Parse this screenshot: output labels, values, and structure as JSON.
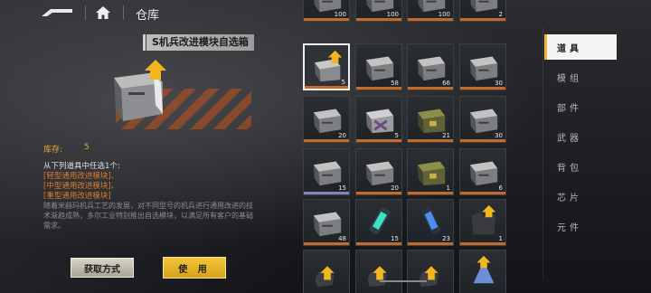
{
  "header": {
    "title": "仓库",
    "back_icon": "back-arrow-icon",
    "home_icon": "home-icon"
  },
  "detail": {
    "item_name": "S机兵改进模块自选箱",
    "stock_label": "库存:",
    "stock_value": "5",
    "choose_text": "从下列道具中任选1个:",
    "options": [
      "[轻型通用改进模块]、",
      "[中型通用改进模块]、",
      "[重型通用改进模块]"
    ],
    "flavor": "随着米赫玛机兵工艺的发展，对不同型号的机兵进行通用改进的技术渐趋成熟，多尔工业特别推出自选模块，以满足所有客户的基础需求。"
  },
  "buttons": {
    "acquire_label": "获取方式",
    "use_label": "使 用"
  },
  "colors": {
    "accent_yellow": "#f0c63c",
    "orange": "#e07a2c",
    "stock": "#e8a63c"
  },
  "grid": {
    "rows": [
      [
        {
          "count": "100",
          "bar": "#c46a2a",
          "icon": "crate"
        },
        {
          "count": "100",
          "bar": "#c46a2a",
          "icon": "crate"
        },
        {
          "count": "100",
          "bar": "#c46a2a",
          "icon": "crate"
        },
        {
          "count": "2",
          "bar": "#c46a2a",
          "icon": "crate"
        }
      ],
      [
        {
          "count": "5",
          "bar": "#c46a2a",
          "icon": "crate-arrow",
          "selected": true
        },
        {
          "count": "58",
          "bar": "#c46a2a",
          "icon": "crate"
        },
        {
          "count": "66",
          "bar": "#c46a2a",
          "icon": "crate"
        },
        {
          "count": "30",
          "bar": "#c46a2a",
          "icon": "crate"
        }
      ],
      [
        {
          "count": "20",
          "bar": "#c46a2a",
          "icon": "crate"
        },
        {
          "count": "5",
          "bar": "#c46a2a",
          "icon": "crate-x"
        },
        {
          "count": "21",
          "bar": "#c46a2a",
          "icon": "crate-green"
        },
        {
          "count": "30",
          "bar": "#c46a2a",
          "icon": "crate"
        }
      ],
      [
        {
          "count": "15",
          "bar": "#7b8ab0",
          "icon": "crate"
        },
        {
          "count": "20",
          "bar": "#c46a2a",
          "icon": "crate"
        },
        {
          "count": "1",
          "bar": "#c46a2a",
          "icon": "crate-green"
        },
        {
          "count": "6",
          "bar": "#c46a2a",
          "icon": "crate"
        }
      ],
      [
        {
          "count": "48",
          "bar": "#c46a2a",
          "icon": "crate"
        },
        {
          "count": "15",
          "bar": "#c46a2a",
          "icon": "canister-teal"
        },
        {
          "count": "23",
          "bar": "#c46a2a",
          "icon": "canister-blue"
        },
        {
          "count": "1",
          "bar": "#c46a2a",
          "icon": "armor-arrow"
        }
      ],
      [
        {
          "count": "",
          "bar": "",
          "icon": "glove-arrow"
        },
        {
          "count": "",
          "bar": "",
          "icon": "glove-arrow"
        },
        {
          "count": "",
          "bar": "",
          "icon": "glove-arrow"
        },
        {
          "count": "",
          "bar": "",
          "icon": "emblem-arrow"
        }
      ]
    ]
  },
  "tabs": [
    {
      "label": "道具",
      "active": true
    },
    {
      "label": "模组",
      "active": false
    },
    {
      "label": "部件",
      "active": false
    },
    {
      "label": "武器",
      "active": false
    },
    {
      "label": "背包",
      "active": false
    },
    {
      "label": "芯片",
      "active": false
    },
    {
      "label": "元件",
      "active": false
    }
  ]
}
